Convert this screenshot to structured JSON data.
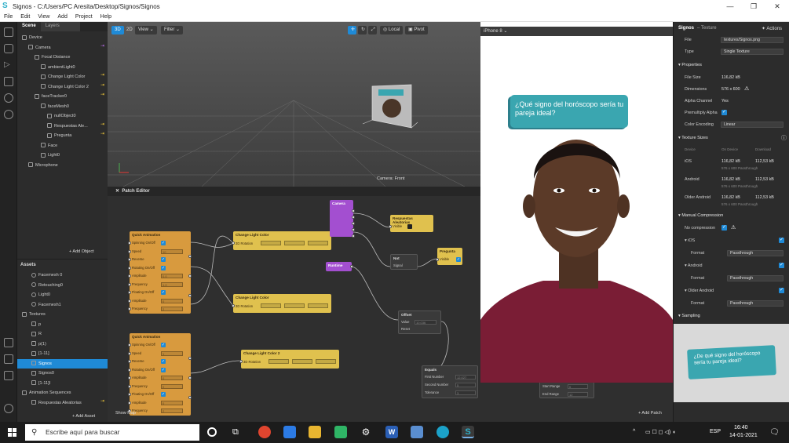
{
  "window": {
    "title": "Signos - C:/Users/PC Aresita/Desktop/Signos/Signos"
  },
  "menu": [
    "File",
    "Edit",
    "View",
    "Add",
    "Project",
    "Help"
  ],
  "scene_panel": {
    "tab_scene": "Scene",
    "tab_layers": "Layers",
    "items": [
      {
        "label": "Device",
        "indent": 0
      },
      {
        "label": "Camera",
        "indent": 1
      },
      {
        "label": "Focal Distance",
        "indent": 2
      },
      {
        "label": "ambientLight0",
        "indent": 3
      },
      {
        "label": "Change Light Color",
        "indent": 3
      },
      {
        "label": "Change Light Color 2",
        "indent": 3
      },
      {
        "label": "faceTracker0",
        "indent": 2
      },
      {
        "label": "faceMesh0",
        "indent": 3
      },
      {
        "label": "nullObject0",
        "indent": 4
      },
      {
        "label": "Respuestas Ale...",
        "indent": 4
      },
      {
        "label": "Pregunta",
        "indent": 4
      },
      {
        "label": "Face",
        "indent": 3
      },
      {
        "label": "Light0",
        "indent": 3
      },
      {
        "label": "Microphone",
        "indent": 1
      }
    ],
    "add_object": "+ Add Object"
  },
  "assets_panel": {
    "title": "Assets",
    "items": [
      {
        "label": "Facemesh 0"
      },
      {
        "label": "Retouching0"
      },
      {
        "label": "Light0"
      },
      {
        "label": "Facemesh1"
      },
      {
        "label": "Textures"
      },
      {
        "label": "p"
      },
      {
        "label": "R"
      },
      {
        "label": "p(1)"
      },
      {
        "label": "[1-11]"
      },
      {
        "label": "Signos"
      },
      {
        "label": "Signos0"
      },
      {
        "label": "[1-11]I"
      },
      {
        "label": "Animation Sequences"
      },
      {
        "label": "Respuestas Aleatorias"
      }
    ],
    "add_asset": "+ Add Asset"
  },
  "viewport": {
    "btn_3d": "3D",
    "btn_2d": "2D",
    "view": "View",
    "filter": "Filter",
    "local": "Local",
    "pivot": "Pivot",
    "camera_label": "Camera: Front"
  },
  "preview": {
    "device": "iPhone 8",
    "question": "¿Qué signo del horóscopo sería tu pareja ideal?"
  },
  "patch_editor": {
    "title": "Patch Editor",
    "show_map": "Show Map",
    "add_patch": "+ Add Patch",
    "nodes": {
      "qa1": {
        "title": "Quick Animation",
        "rows": [
          "Spinning On/Off",
          "Speed",
          "Reverse",
          "Rotating On/Off",
          "Amplitude",
          "Frequency",
          "Floating On/Off",
          "Amplitude",
          "Frequency"
        ],
        "vals": [
          "",
          "10",
          "",
          "",
          "0.0",
          "1.0",
          "",
          "0",
          "2"
        ]
      },
      "qa2": {
        "title": "Quick Animation",
        "rows": [
          "Spinning On/Off",
          "Speed",
          "Reverse",
          "Rotating On/Off",
          "Amplitude",
          "Frequency",
          "Floating On/Off",
          "Amplitude",
          "Frequency"
        ],
        "vals": [
          "",
          "1",
          "",
          "",
          "0",
          "0",
          "",
          "0",
          "2"
        ]
      },
      "clc1": {
        "title": "Change Light Color",
        "row": "3D Rotation"
      },
      "clc2": {
        "title": "Change Light Color",
        "row": "3D Rotation"
      },
      "clc3": {
        "title": "Change Light Color 2",
        "row": "3D Rotation"
      },
      "camera": {
        "title": "Camera"
      },
      "resp": {
        "title": "Respuestas Aleatorias",
        "row": "Visible"
      },
      "preg": {
        "title": "Pregunta",
        "row": "Visible"
      },
      "not": {
        "title": "Not",
        "row": "Signal"
      },
      "runtime": {
        "title": "Runtime"
      },
      "offset": {
        "title": "Offset",
        "rows": [
          "Value",
          "Reset"
        ],
        "value": "10.036"
      },
      "equals": {
        "title": "Equals",
        "rows": [
          "First Number",
          "Second Number",
          "Tolerance"
        ],
        "vals": [
          "12.027",
          "5",
          "3"
        ]
      },
      "range": {
        "rows": [
          "Start Range",
          "End Range"
        ],
        "vals": [
          "0",
          "12"
        ]
      }
    }
  },
  "inspector": {
    "title": "Signos",
    "subtitle": "– Texture",
    "actions": "Actions",
    "file_label": "File",
    "file_value": "textures/Signos.png",
    "type_label": "Type",
    "type_value": "Single Texture",
    "properties": "Properties",
    "file_size_label": "File Size",
    "file_size": "116,82 kB",
    "dimensions_label": "Dimensions",
    "dimensions": "576 x 600",
    "alpha_label": "Alpha Channel",
    "alpha": "Yes",
    "premult_label": "Premultiply Alpha",
    "color_enc_label": "Color Encoding",
    "color_enc": "Linear",
    "texture_sizes": "Texture Sizes",
    "col_device": "Device",
    "col_on_device": "On Device",
    "col_download": "Download",
    "sizes": [
      {
        "device": "iOS",
        "on": "116,82 kB",
        "dl": "112,53 kB",
        "sub": "576 x 600 Passthrough"
      },
      {
        "device": "Android",
        "on": "116,82 kB",
        "dl": "112,53 kB",
        "sub": "576 x 600 Passthrough"
      },
      {
        "device": "Older Android",
        "on": "116,82 kB",
        "dl": "112,53 kB",
        "sub": "576 x 600 Passthrough"
      }
    ],
    "manual_comp": "Manual Compression",
    "no_comp": "No compression",
    "ios": "iOS",
    "android": "Android",
    "older_android": "Older Android",
    "format_label": "Format",
    "format_value": "Passthrough",
    "sampling": "Sampling",
    "thumb_text": "¿De qué signo del horóscopo sería tu pareja ideal?"
  },
  "taskbar": {
    "search_placeholder": "Escribe aquí para buscar",
    "lang": "ESP",
    "time": "16:40",
    "date": "14-01-2021"
  },
  "colors": {
    "accent": "#1f8ad6",
    "patch_node": "#d89a3e",
    "patch_yellow": "#e0c14e",
    "patch_purple": "#a34fd0",
    "question_box": "#3aa6b0"
  }
}
